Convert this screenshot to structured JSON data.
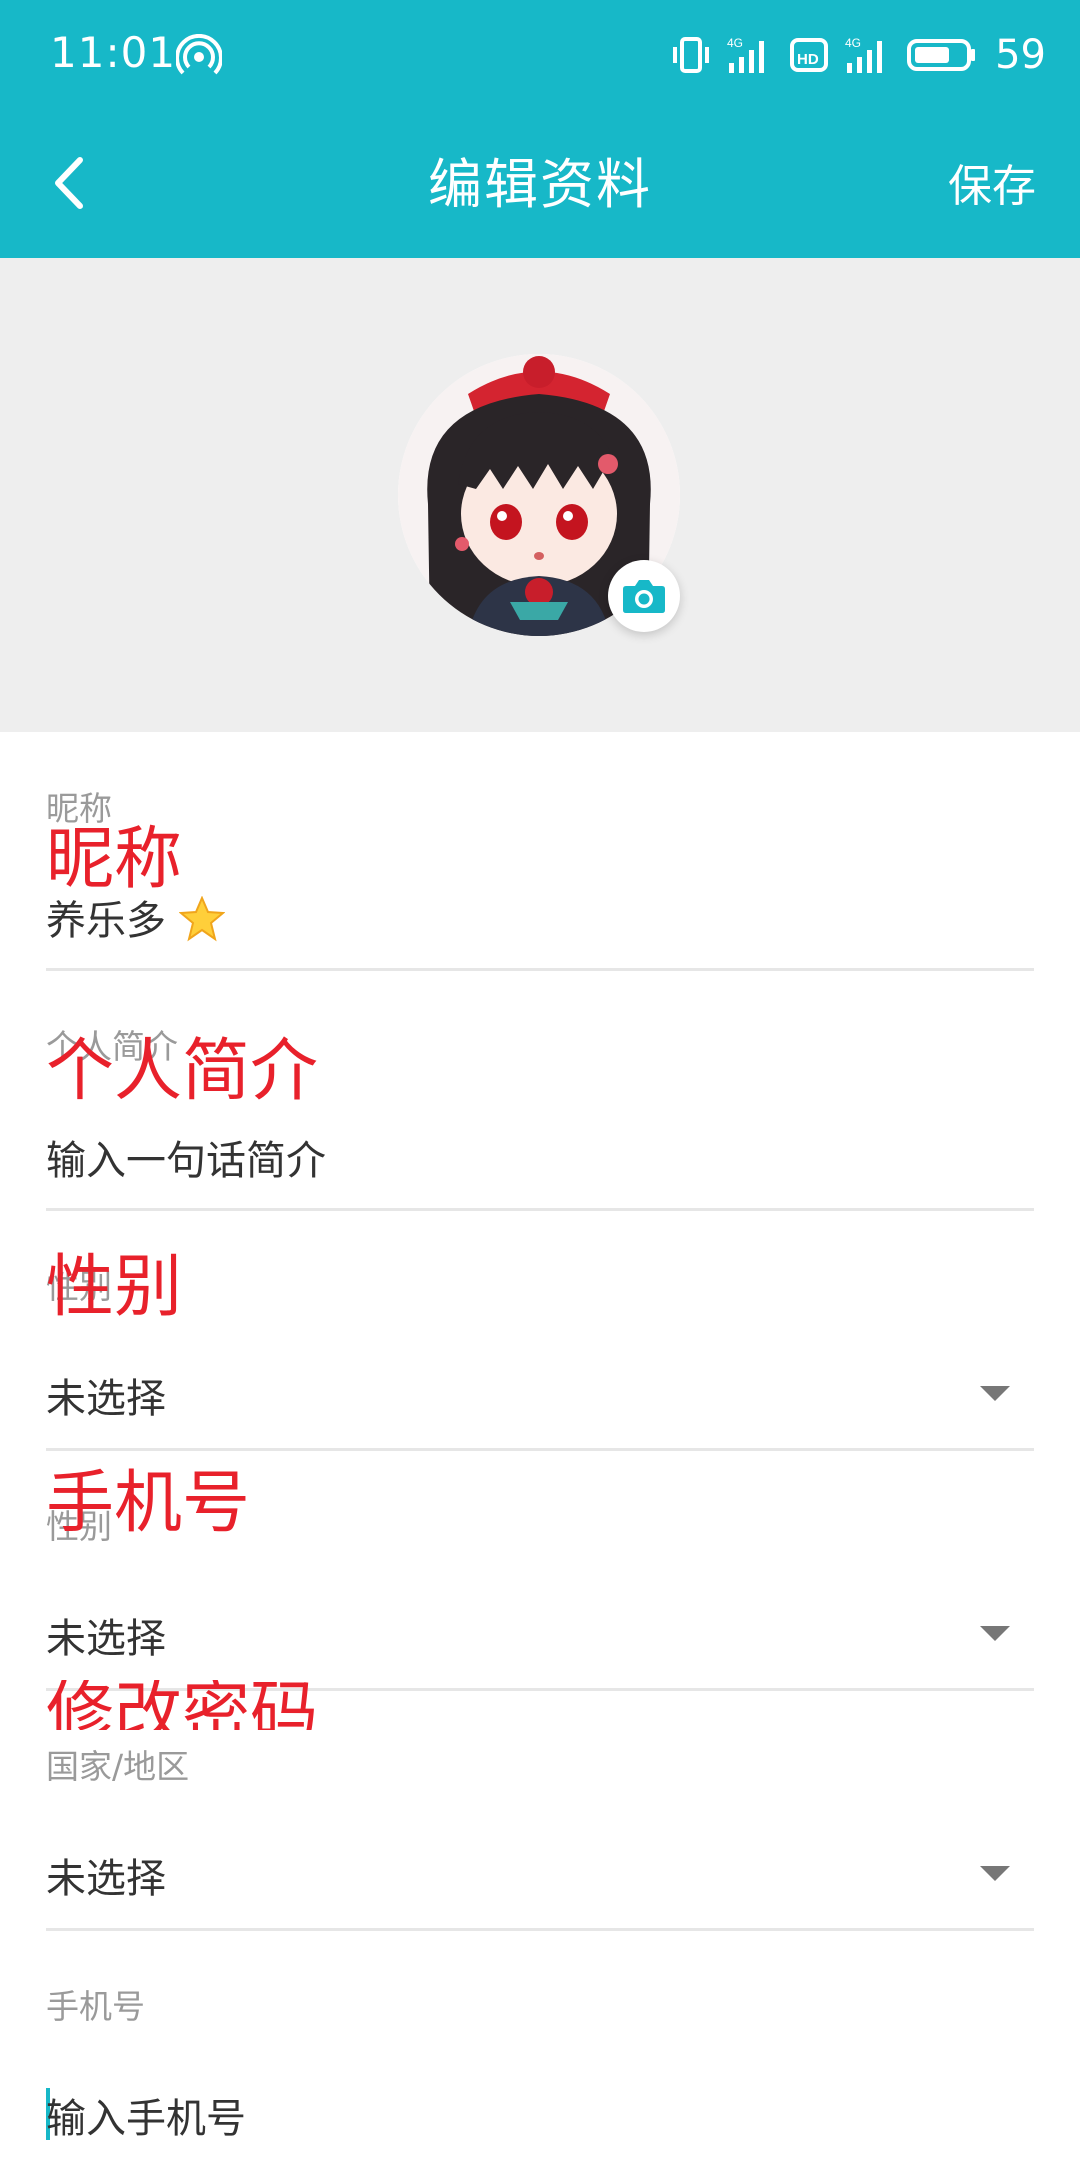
{
  "status_bar": {
    "time": "11:01",
    "battery_level": "59",
    "icons": [
      "hotspot-icon",
      "vibrate-icon",
      "signal-4g-icon",
      "hd-icon",
      "signal-4g-icon",
      "battery-icon"
    ]
  },
  "header": {
    "title": "编辑资料",
    "save_label": "保存",
    "back_icon": "back-arrow-icon"
  },
  "avatar": {
    "camera_icon": "camera-icon"
  },
  "fields": {
    "nickname": {
      "label": "昵称",
      "value": "养乐多"
    },
    "bio": {
      "label": "个人简介",
      "placeholder": "输入一句话简介"
    },
    "gender1": {
      "label": "性别",
      "value": "未选择"
    },
    "gender2": {
      "label": "性别",
      "value": "未选择"
    },
    "country": {
      "label": "国家/地区",
      "value": "未选择"
    },
    "phone": {
      "label": "手机号",
      "placeholder": "输入手机号"
    }
  },
  "overlay_labels": {
    "nickname": "昵称",
    "bio": "个人简介",
    "gender": "性别",
    "phone": "手机号",
    "password": "修改密码"
  },
  "colors": {
    "accent": "#17b8c8",
    "overlay_red": "#e8212b",
    "avatar_bg": "#eeeeee"
  }
}
